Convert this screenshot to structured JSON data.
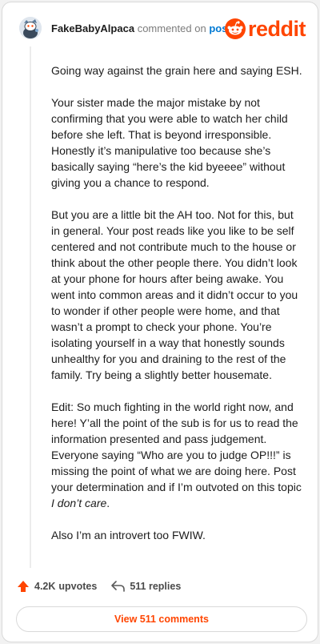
{
  "header": {
    "username": "FakeBabyAlpaca",
    "action": "commented on",
    "target": "post",
    "brand": "reddit",
    "avatar_icon": "snoo-avatar-icon",
    "logo_icon": "snoo-logo-icon",
    "brand_color": "#ff4500"
  },
  "comment": {
    "paragraphs": [
      "Going way against the grain here and saying ESH.",
      "Your sister made the major mistake by not confirming that you were able to watch her child before she left. That is beyond irresponsible. Honestly it’s manipulative too because she’s basically saying “here’s the kid byeeee” without giving you a chance to respond.",
      "But you are a little bit the AH too. Not for this, but in general. Your post reads like you like to be self centered and not contribute much to the house or think about the other people there. You didn’t look at your phone for hours after being awake. You went into common areas and it didn’t occur to you to wonder if other people were home, and that wasn’t a prompt to check your phone. You’re isolating yourself in a way that honestly sounds unhealthy for you and draining to the rest of the family. Try being a slightly better housemate."
    ],
    "edit_text": "Edit: So much fighting in the world right now, and here! Y’all the point of the sub is for us to read the information presented and pass judgement. Everyone saying “Who are you to judge OP!!!” is missing the point of what we are doing here. Post your determination and if I’m outvoted on this topic ",
    "edit_emphasis": "I don’t care",
    "edit_end": ".",
    "closing": "Also I’m an introvert too FWIW."
  },
  "footer": {
    "upvotes_count": "4.2K",
    "upvotes_label": "upvotes",
    "upvote_icon": "upvote-arrow-icon",
    "reply_icon": "reply-arrow-icon",
    "replies": "511 replies",
    "view_button": "View 511 comments"
  }
}
